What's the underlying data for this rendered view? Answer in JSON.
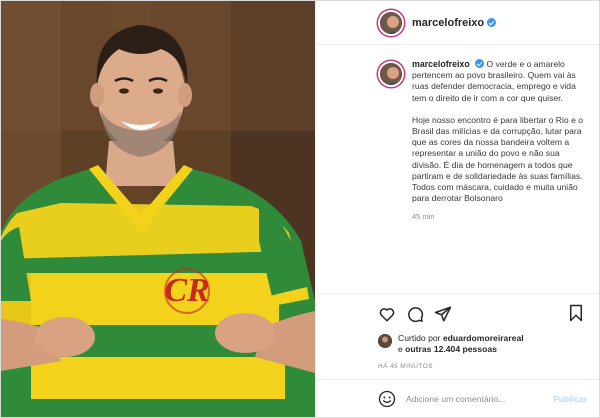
{
  "post": {
    "username": "marcelofreixo",
    "caption": {
      "paragraph1": "O verde e o amarelo pertencem ao povo brasileiro. Quem vai às ruas defender democracia, emprego e vida tem o direito de ir com a cor que quiser.",
      "paragraph2": "Hoje nosso encontro é para libertar o Rio e o Brasil das milícias e da corrupção, lutar para que as cores da nossa bandeira voltem a representar a união do povo e não sua divisão. É dia de homenagem a todos que partiram e de solidariedade às suas famílias. Todos com máscara, cuidado e muita união para derrotar Bolsonaro"
    },
    "caption_time": "45 min",
    "likes": {
      "prefix": "Curtido por",
      "user": "eduardomoreirareal",
      "middle": "e",
      "others": "outras 12.404 pessoas"
    },
    "posted_ago": "HÁ 45 MINUTOS",
    "comment": {
      "placeholder": "Adicione um comentário...",
      "publish_label": "Publicar"
    }
  },
  "icons": {
    "verified": "verified-badge-icon",
    "like": "heart-icon",
    "comment": "comment-bubble-icon",
    "share": "paper-plane-icon",
    "save": "bookmark-icon",
    "emoji": "smiley-icon"
  },
  "colors": {
    "verified": "#3897f0",
    "publish_disabled": "#b3dbff",
    "shirt_green": "#2f8a3a",
    "shirt_yellow": "#f2d21b"
  }
}
